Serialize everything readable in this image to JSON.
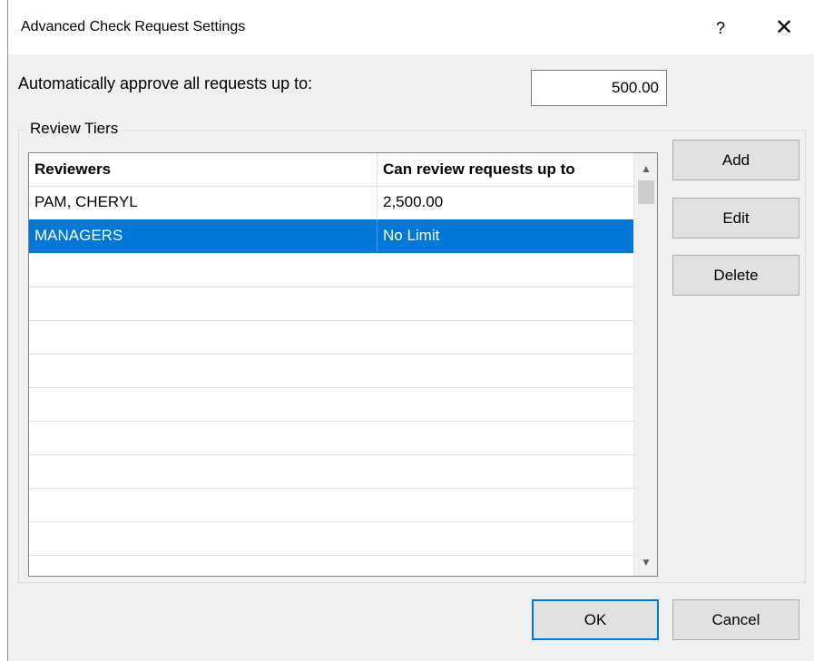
{
  "window": {
    "title": "Advanced Check Request Settings",
    "help_glyph": "?",
    "close_glyph": "✕"
  },
  "approve": {
    "label": "Automatically approve all requests up to:",
    "value": "500.00"
  },
  "review_tiers": {
    "label": "Review Tiers",
    "columns": [
      "Reviewers",
      "Can review requests up to"
    ],
    "rows": [
      {
        "reviewer": "PAM, CHERYL",
        "limit": "2,500.00"
      },
      {
        "reviewer": "MANAGERS",
        "limit": "No Limit"
      }
    ],
    "selected_row": 1,
    "empty_row_count": 10
  },
  "buttons": {
    "add": "Add",
    "edit": "Edit",
    "delete": "Delete",
    "ok": "OK",
    "cancel": "Cancel"
  },
  "colors": {
    "selection": "#0078d7",
    "dialog_bg": "#f0f0f0"
  }
}
